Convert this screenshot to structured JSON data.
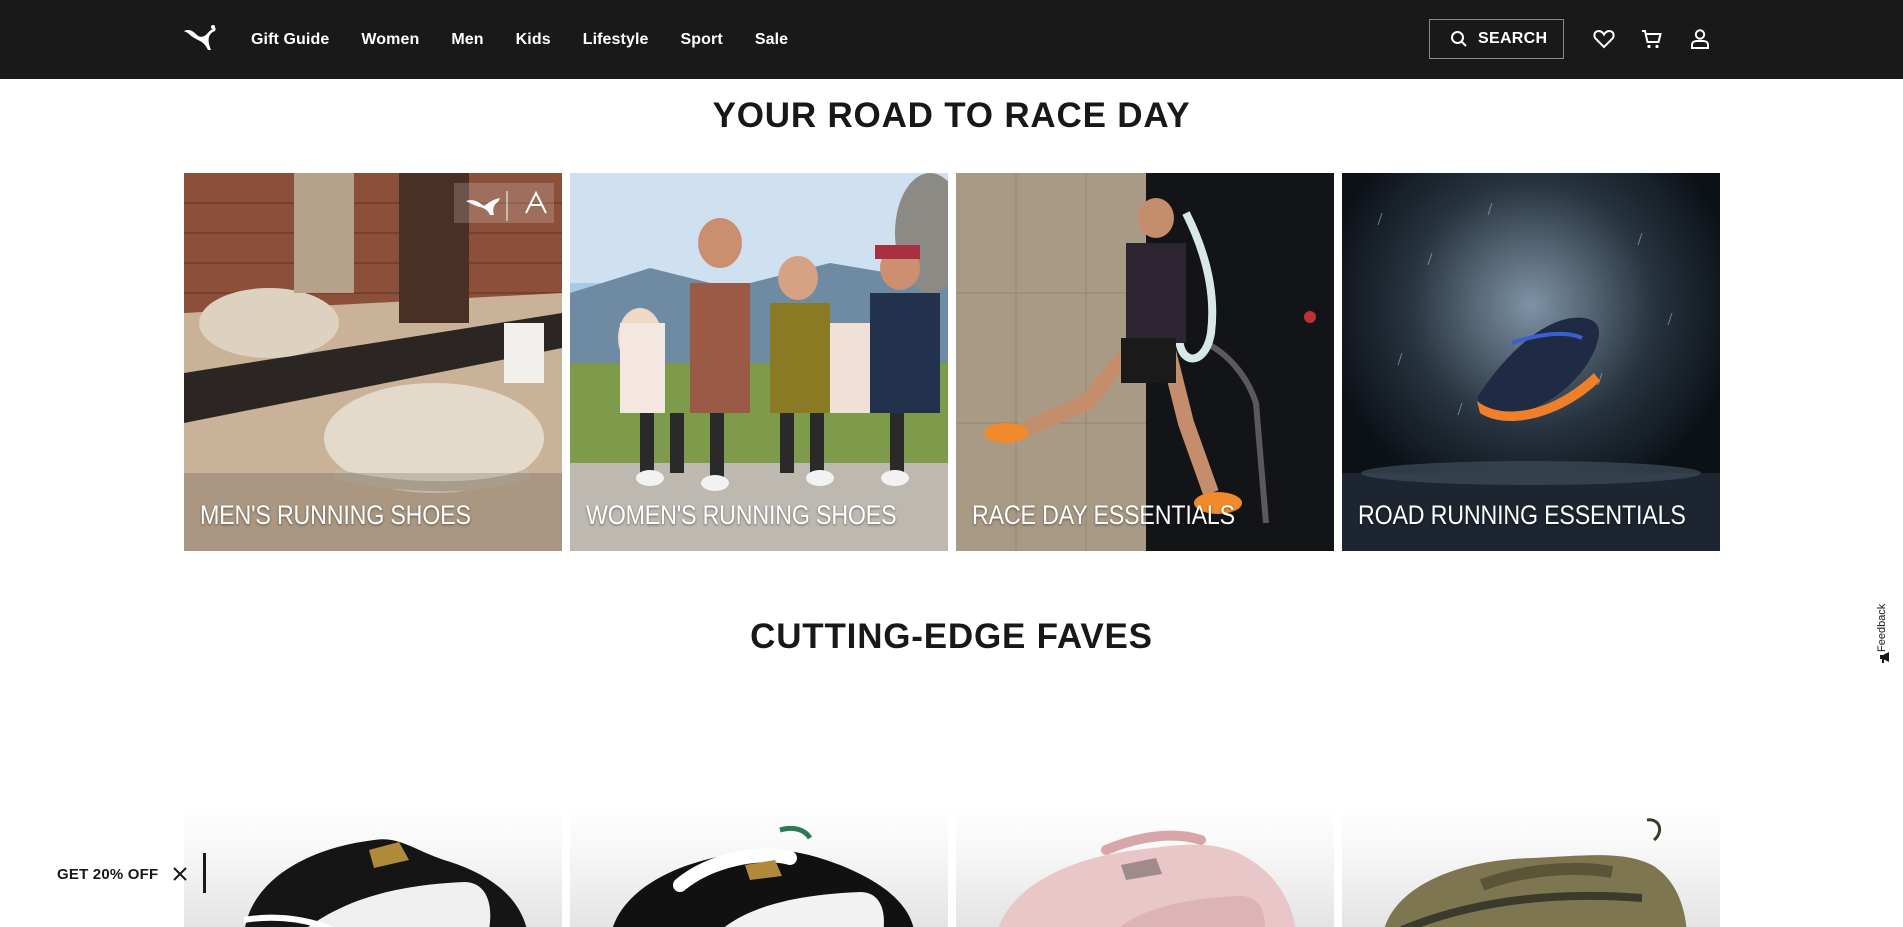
{
  "header": {
    "nav": [
      {
        "label": "Gift Guide"
      },
      {
        "label": "Women"
      },
      {
        "label": "Men"
      },
      {
        "label": "Kids"
      },
      {
        "label": "Lifestyle"
      },
      {
        "label": "Sport"
      },
      {
        "label": "Sale"
      }
    ],
    "search_label": "SEARCH",
    "icons": [
      "puma-logo-icon",
      "search-icon",
      "heart-icon",
      "cart-icon",
      "account-icon"
    ]
  },
  "race_section": {
    "title": "YOUR ROAD TO RACE DAY",
    "tiles": [
      {
        "label": "MEN'S RUNNING SHOES"
      },
      {
        "label": "WOMEN'S RUNNING SHOES"
      },
      {
        "label": "RACE DAY ESSENTIALS"
      },
      {
        "label": "ROAD RUNNING ESSENTIALS"
      }
    ]
  },
  "faves_section": {
    "title": "CUTTING-EDGE FAVES",
    "products": [
      {
        "colorway": "black-white"
      },
      {
        "colorway": "black-white"
      },
      {
        "colorway": "pink"
      },
      {
        "colorway": "olive"
      }
    ]
  },
  "promo": {
    "label": "GET 20% OFF"
  },
  "feedback": {
    "label": "Feedback"
  },
  "colors": {
    "nav_bg": "#191919",
    "text": "#181818",
    "white": "#ffffff"
  }
}
